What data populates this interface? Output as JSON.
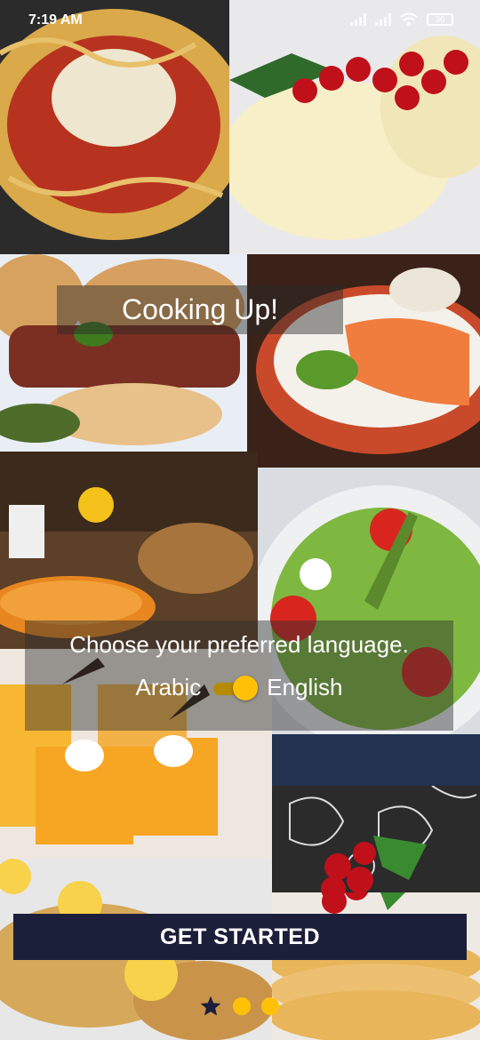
{
  "status": {
    "time": "7:19 AM",
    "battery": "36"
  },
  "title": "Cooking Up!",
  "language": {
    "prompt": "Choose your preferred language.",
    "option_left": "Arabic",
    "option_right": "English",
    "selected": "English"
  },
  "cta": "GET STARTED",
  "pager": {
    "count": 3,
    "active": 0
  },
  "colors": {
    "accent": "#ffc107",
    "button": "#1b1f3a"
  },
  "icons": [
    "star-icon",
    "wifi-icon",
    "signal-icon",
    "battery-icon"
  ]
}
